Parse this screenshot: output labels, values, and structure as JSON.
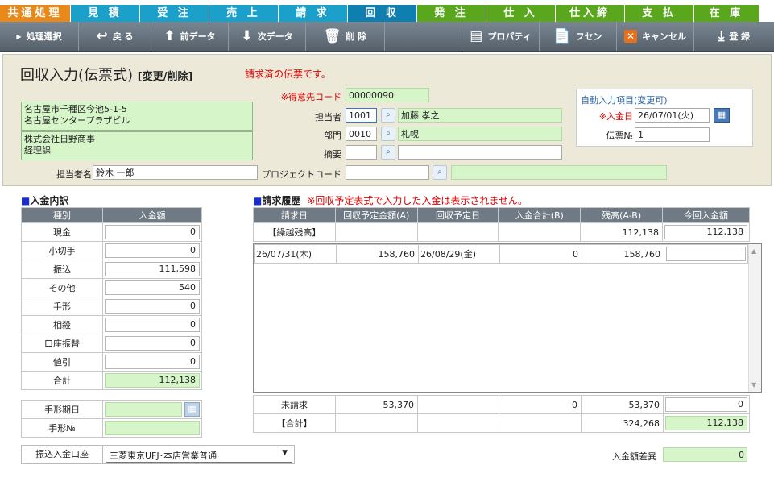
{
  "tabs": [
    {
      "label": "共通処理",
      "color": "#e8891a"
    },
    {
      "label": "見 積",
      "color": "#1aa0c9"
    },
    {
      "label": "受 注",
      "color": "#1aa0c9"
    },
    {
      "label": "売 上",
      "color": "#1aa0c9"
    },
    {
      "label": "請 求",
      "color": "#1aa0c9"
    },
    {
      "label": "回 収",
      "color": "#1aa0c9"
    },
    {
      "label": "発 注",
      "color": "#5aa71d"
    },
    {
      "label": "仕 入",
      "color": "#5aa71d"
    },
    {
      "label": "仕入締",
      "color": "#5aa71d"
    },
    {
      "label": "支 払",
      "color": "#5aa71d"
    },
    {
      "label": "在 庫",
      "color": "#5aa71d"
    }
  ],
  "toolbar": {
    "menu_select": "処理選択",
    "back": "戻 る",
    "prev_data": "前データ",
    "next_data": "次データ",
    "delete": "削 除",
    "property": "プロパティ",
    "sticky": "フセン",
    "cancel": "キャンセル",
    "register": "登 録"
  },
  "header": {
    "title": "回収入力(伝票式)",
    "subtitle": "[変更/削除]",
    "notice": "請求済の伝票です。",
    "address": [
      "名古屋市千種区今池5-1-5",
      "名古屋センタープラザビル"
    ],
    "company": [
      "株式会社日野商事",
      "経理課"
    ],
    "contact_label": "担当者名",
    "contact_value": "鈴木 一郎",
    "customer_code_label": "※得意先コード",
    "customer_code_value": "00000090",
    "staff_label": "担当者",
    "staff_code": "1001",
    "staff_name": "加藤 孝之",
    "dept_label": "部門",
    "dept_code": "0010",
    "dept_name": "札幌",
    "summary_label": "摘要",
    "summary_code": "",
    "summary_name": "",
    "project_label": "プロジェクトコード",
    "project_code": "",
    "project_name": ""
  },
  "auto": {
    "title": "自動入力項目(変更可)",
    "date_label": "※入金日",
    "date_value": "26/07/01(火)",
    "slip_label": "伝票№",
    "slip_value": "1"
  },
  "breakdown": {
    "title": "入金内訳",
    "col_type": "種別",
    "col_amount": "入金額",
    "rows": [
      {
        "type": "現金",
        "amount": "0"
      },
      {
        "type": "小切手",
        "amount": "0"
      },
      {
        "type": "振込",
        "amount": "111,598"
      },
      {
        "type": "その他",
        "amount": "540"
      },
      {
        "type": "手形",
        "amount": "0"
      },
      {
        "type": "相殺",
        "amount": "0"
      },
      {
        "type": "口座振替",
        "amount": "0"
      },
      {
        "type": "値引",
        "amount": "0"
      }
    ],
    "total_label": "合計",
    "total_value": "112,138",
    "bill_date_label": "手形期日",
    "bill_no_label": "手形№",
    "bank_label": "振込入金口座",
    "bank_value": "三菱東京UFJ･本店営業普通"
  },
  "history": {
    "title": "請求履歴",
    "note": "※回収予定表式で入力した入金は表示されません。",
    "columns": [
      "請求日",
      "回収予定金額(A)",
      "回収予定日",
      "入金合計(B)",
      "残高(A-B)",
      "今回入金額"
    ],
    "carry_label": "【繰越残高】",
    "carry_balance": "112,138",
    "carry_payment": "112,138",
    "rows": [
      {
        "date": "26/07/31(木)",
        "planned": "158,760",
        "plan_date": "26/08/29(金)",
        "paid": "0",
        "balance": "158,760",
        "payment": ""
      }
    ],
    "unbilled_label": "未請求",
    "unbilled_planned": "53,370",
    "unbilled_paid": "0",
    "unbilled_balance": "53,370",
    "unbilled_payment": "0",
    "total_label": "【合計】",
    "total_balance": "324,268",
    "total_payment": "112,138",
    "diff_label": "入金額差異",
    "diff_value": "0"
  }
}
